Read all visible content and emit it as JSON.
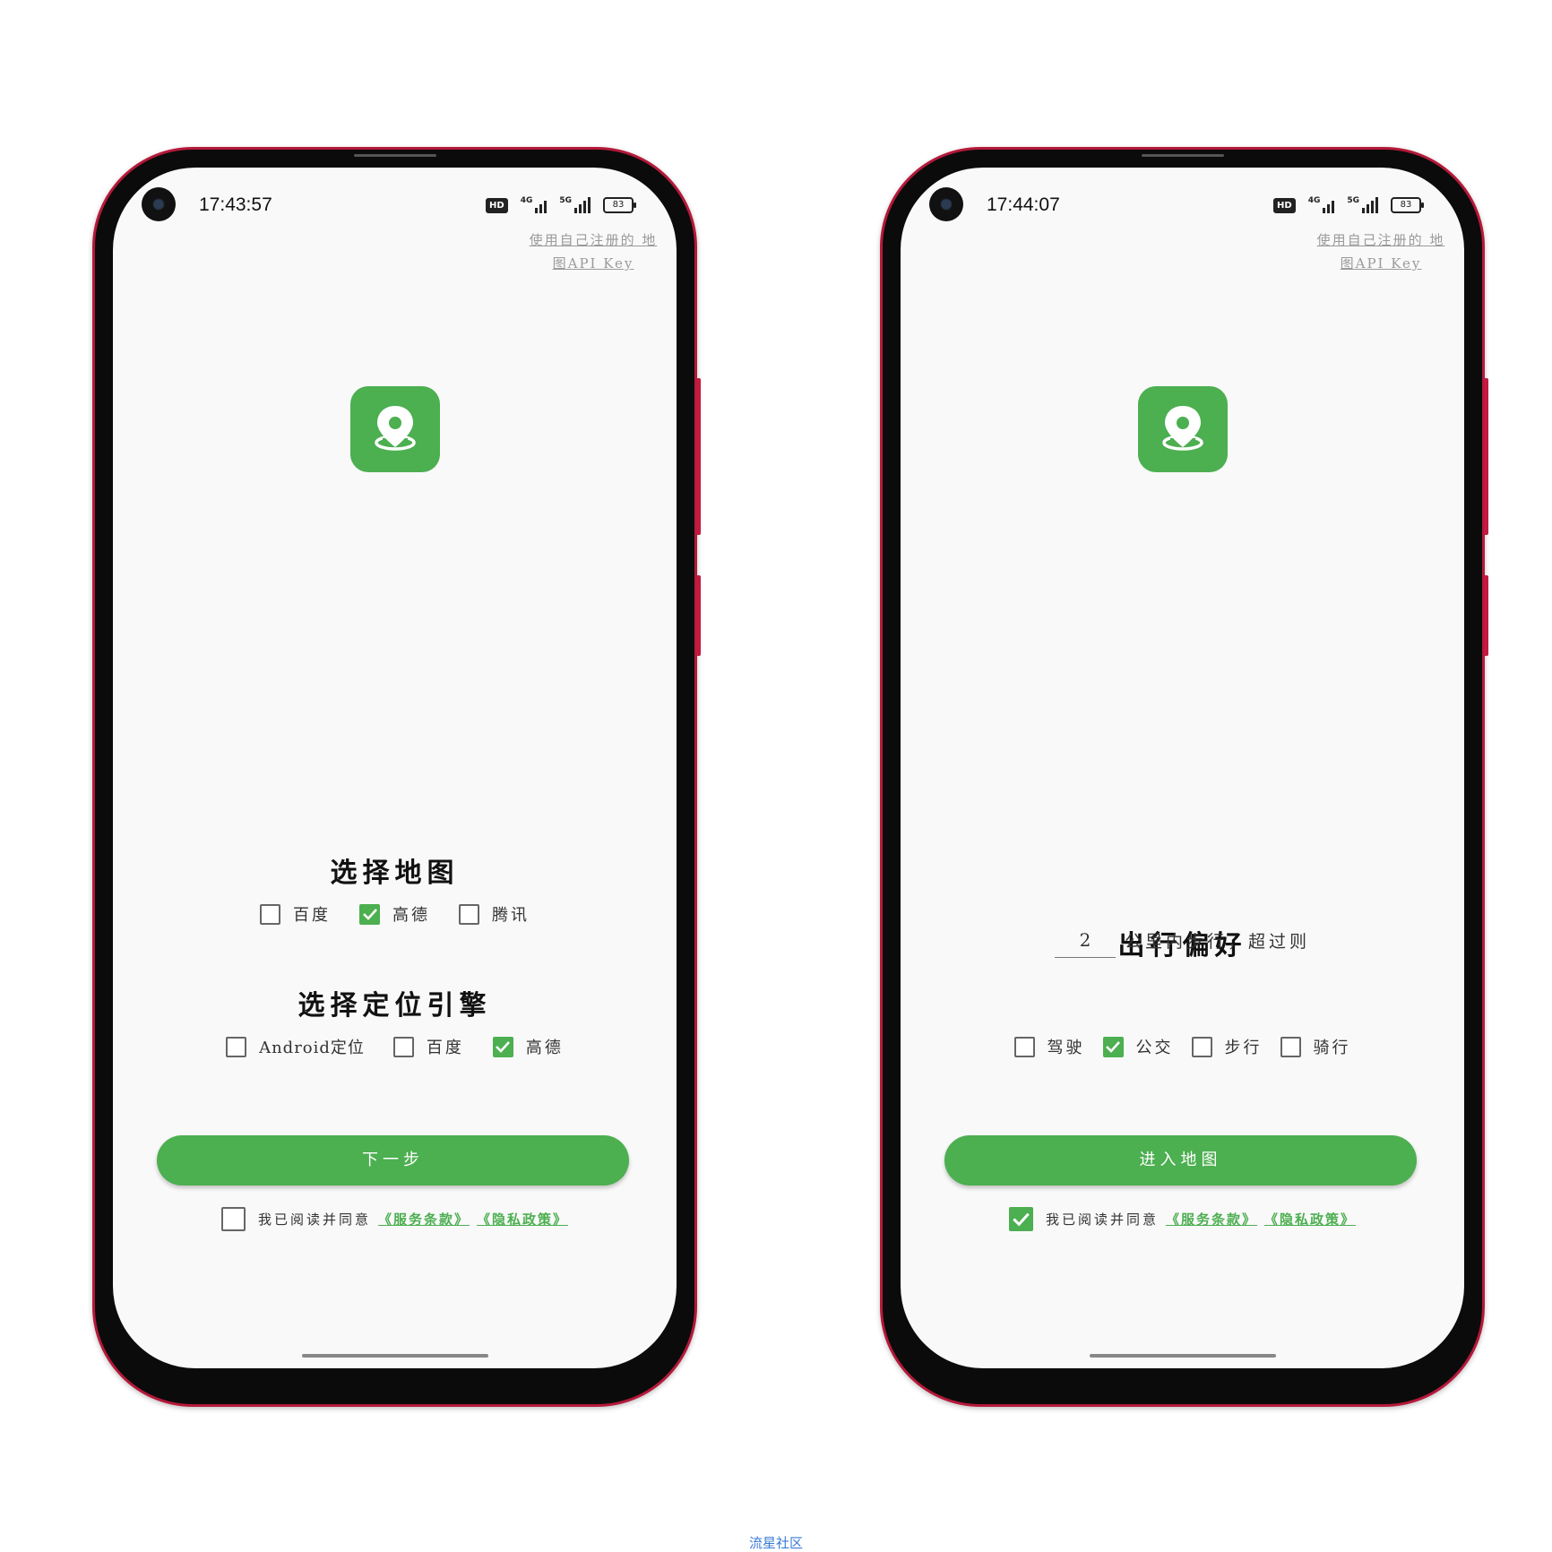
{
  "screens": [
    {
      "time": "17:43:57",
      "status": {
        "hd": "HD",
        "net1": "4G",
        "net2": "5G",
        "battery": "83"
      },
      "api_link": "使用自己注册的 地图API Key",
      "icon": "map-location-pin-icon",
      "map_section": {
        "title": "选择地图",
        "options": [
          {
            "label": "百度",
            "checked": false
          },
          {
            "label": "高德",
            "checked": true
          },
          {
            "label": "腾讯",
            "checked": false
          }
        ]
      },
      "locate_section": {
        "title": "选择定位引擎",
        "options": [
          {
            "label": "Android定位",
            "checked": false
          },
          {
            "label": "百度",
            "checked": false
          },
          {
            "label": "高德",
            "checked": true
          }
        ]
      },
      "primary_button": "下一步",
      "agreement": {
        "checked": false,
        "text": "我已阅读并同意",
        "terms": "《服务条款》",
        "privacy": "《隐私政策》"
      }
    },
    {
      "time": "17:44:07",
      "status": {
        "hd": "HD",
        "net1": "4G",
        "net2": "5G",
        "battery": "83"
      },
      "api_link": "使用自己注册的 地图API Key",
      "icon": "map-location-pin-icon",
      "travel_section": {
        "title": "出行偏好",
        "walk_distance": "2",
        "walk_suffix": "公里内步行，超过则",
        "options": [
          {
            "label": "驾驶",
            "checked": false
          },
          {
            "label": "公交",
            "checked": true
          },
          {
            "label": "步行",
            "checked": false
          },
          {
            "label": "骑行",
            "checked": false
          }
        ]
      },
      "primary_button": "进入地图",
      "agreement": {
        "checked": true,
        "text": "我已阅读并同意",
        "terms": "《服务条款》",
        "privacy": "《隐私政策》"
      }
    }
  ],
  "watermark": "流星社区",
  "colors": {
    "accent": "#4caf50",
    "phone_frame": "#b5193a",
    "link_gray": "#9a9a9a",
    "watermark": "#3a7bd5"
  }
}
